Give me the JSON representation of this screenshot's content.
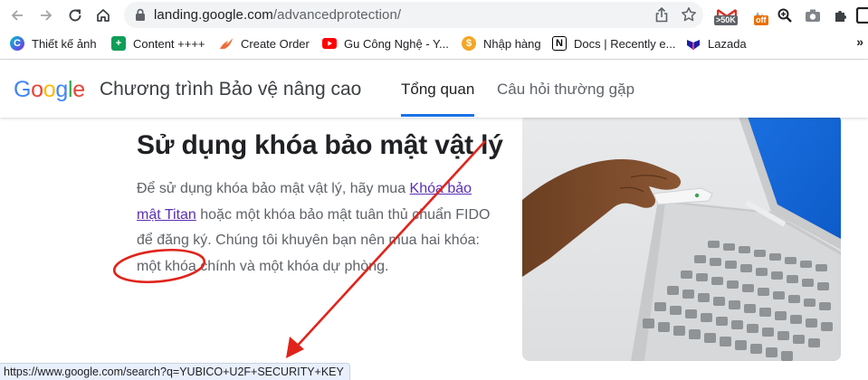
{
  "browser": {
    "url_host": "landing.google.com",
    "url_path": "/advancedprotection/",
    "extensions": [
      {
        "name": "gmail-extension-icon",
        "badge": ">50K",
        "badge_color": "#5f6368"
      },
      {
        "name": "offer-extension-icon",
        "badge": "off",
        "badge_color": "#e8710a"
      },
      {
        "name": "zoom-extension-icon"
      },
      {
        "name": "camera-extension-icon"
      },
      {
        "name": "puzzle-extensions-icon"
      }
    ],
    "status_url": "https://www.google.com/search?q=YUBICO+U2F+SECURITY+KEY"
  },
  "bookmarks": [
    {
      "label": "Thiết kế ảnh",
      "icon": "canva-icon",
      "color": "#00c4cc"
    },
    {
      "label": "Content ++++",
      "icon": "sheets-icon",
      "color": "#0f9d58"
    },
    {
      "label": "Create Order",
      "icon": "flame-icon",
      "color": "#f26b3a"
    },
    {
      "label": "Gu Công Nghệ - Y...",
      "icon": "youtube-icon",
      "color": "#ff0000"
    },
    {
      "label": "Nhập hàng",
      "icon": "coin-icon",
      "color": "#f5a623"
    },
    {
      "label": "Docs | Recently e...",
      "icon": "notion-icon",
      "color": "#000000"
    },
    {
      "label": "Lazada",
      "icon": "lazada-icon",
      "color": "#1a1fa8"
    }
  ],
  "header": {
    "logo": [
      "G",
      "o",
      "o",
      "g",
      "l",
      "e"
    ],
    "product_name": "Chương trình Bảo vệ nâng cao",
    "tabs": [
      {
        "label": "Tổng quan",
        "active": true
      },
      {
        "label": "Câu hỏi thường gặp",
        "active": false
      }
    ]
  },
  "content": {
    "title": "Sử dụng khóa bảo mật vật lý",
    "para_before": "Để sử dụng khóa bảo mật vật lý, hãy mua ",
    "para_link": "Khóa bảo mật Titan",
    "para_after": " hoặc một khóa bảo mật tuân thủ chuẩn FIDO để đăng ký. Chúng tôi khuyên bạn nên mua hai khóa: một khóa chính và một khóa dự phòng."
  },
  "colors": {
    "accent": "#1a73e8",
    "link": "#5b2fb6",
    "annotation": "#e0241b"
  }
}
